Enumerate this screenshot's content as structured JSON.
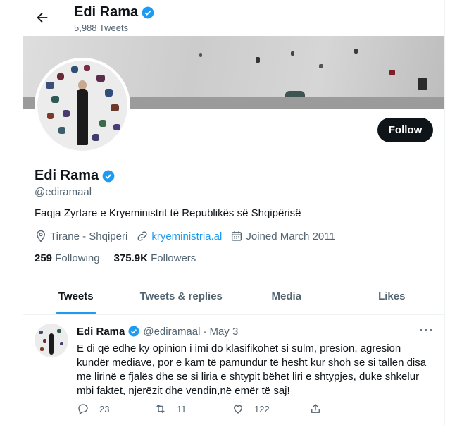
{
  "header": {
    "name": "Edi Rama",
    "tweet_count": "5,988 Tweets"
  },
  "profile": {
    "name": "Edi Rama",
    "handle": "@ediramaal",
    "bio": "Faqja Zyrtare e Kryeministrit të Republikës së Shqipërisë",
    "location": "Tirane - Shqipëri",
    "website": "kryeministria.al",
    "joined": "Joined March 2011",
    "following_count": "259",
    "following_label": "Following",
    "followers_count": "375.9K",
    "followers_label": "Followers",
    "follow_label": "Follow"
  },
  "tabs": [
    {
      "label": "Tweets",
      "active": true
    },
    {
      "label": "Tweets & replies"
    },
    {
      "label": "Media"
    },
    {
      "label": "Likes"
    }
  ],
  "tweet": {
    "name": "Edi Rama",
    "handle": "@ediramaal",
    "sep": "·",
    "date": "May 3",
    "text": "E di që edhe ky opinion i imi do klasifikohet si sulm, presion, agresion kundër mediave, por e kam të pamundur të hesht kur shoh se si tallen disa me lirinë e fjalës dhe se si liria e shtypit bëhet liri e shtypjes, duke shkelur mbi faktet, njerëzit dhe vendin,në emër të saj!",
    "replies": "23",
    "retweets": "11",
    "likes": "122",
    "more": "···"
  },
  "colors": {
    "accent": "#1d9bf0",
    "text": "#0f1419",
    "secondary": "#536471"
  },
  "icons": [
    "back-arrow-icon",
    "verified-badge-icon",
    "location-icon",
    "link-icon",
    "calendar-icon",
    "reply-icon",
    "retweet-icon",
    "like-icon",
    "share-icon",
    "more-icon"
  ]
}
